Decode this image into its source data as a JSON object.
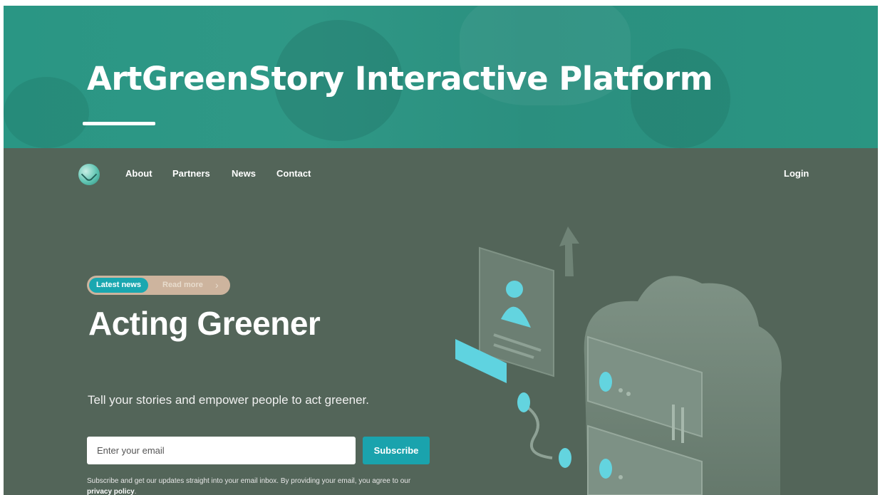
{
  "banner": {
    "title": "ArtGreenStory Interactive Platform"
  },
  "nav": {
    "items": [
      {
        "label": "About"
      },
      {
        "label": "Partners"
      },
      {
        "label": "News"
      },
      {
        "label": "Contact"
      }
    ],
    "login": "Login"
  },
  "hero": {
    "badge_tag": "Latest news",
    "badge_link": "Read more",
    "badge_chevron": "›",
    "title": "Acting Greener",
    "subtitle": "Tell your stories and empower people to act greener."
  },
  "subscribe": {
    "placeholder": "Enter your email",
    "button": "Subscribe",
    "legal_text": "Subscribe and get our updates straight into your email inbox. By providing your email, you agree to our ",
    "legal_link": "privacy policy",
    "legal_end": "."
  },
  "colors": {
    "banner_teal": "#2a9684",
    "body_green": "#536559",
    "accent_teal": "#1aa7b0",
    "pill_tan": "#cdb49e"
  },
  "icons": [
    "leaf-logo-icon",
    "chevron-right-icon"
  ]
}
